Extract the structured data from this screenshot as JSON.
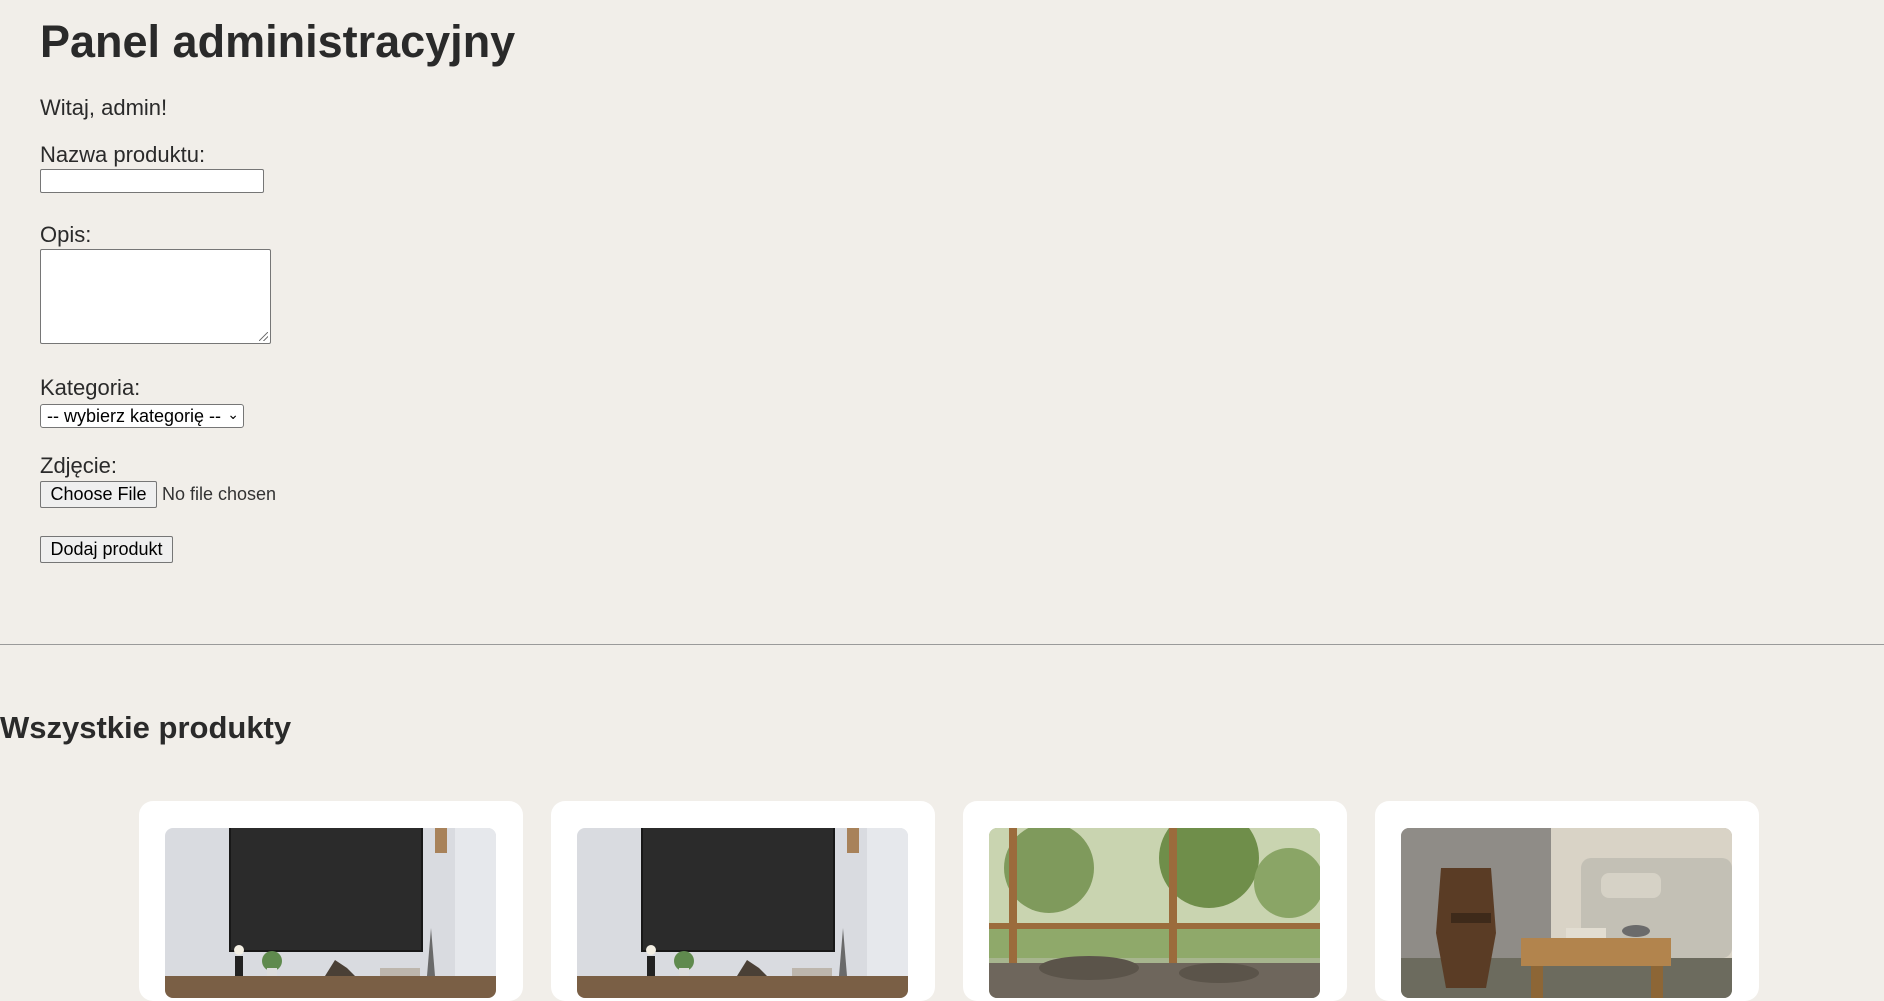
{
  "page_title": "Panel administracyjny",
  "welcome": "Witaj, admin!",
  "form": {
    "name_label": "Nazwa produktu:",
    "name_value": "",
    "description_label": "Opis:",
    "description_value": "",
    "category_label": "Kategoria:",
    "category_selected": "-- wybierz kategorię --",
    "image_label": "Zdjęcie:",
    "file_button": "Choose File",
    "file_status": "No file chosen",
    "submit": "Dodaj produkt"
  },
  "products_heading": "Wszystkie produkty",
  "products": [
    {
      "image": "tv-stand-photo"
    },
    {
      "image": "tv-stand-photo"
    },
    {
      "image": "sofa-garden-window-photo"
    },
    {
      "image": "living-room-coffee-table-photo"
    }
  ]
}
